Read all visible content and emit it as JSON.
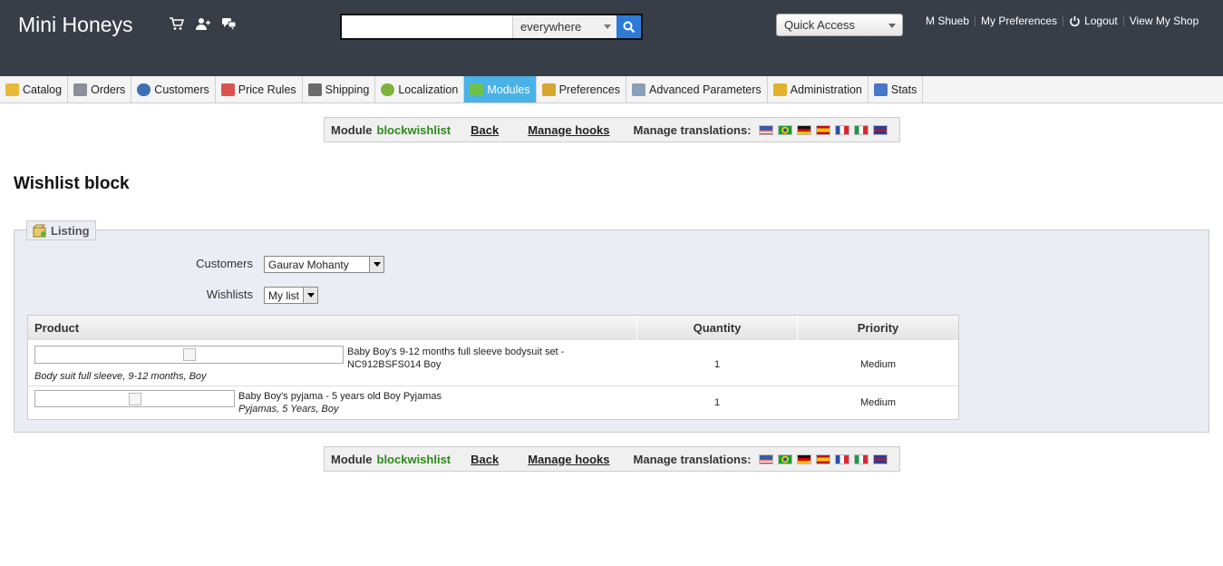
{
  "header": {
    "shop_name": "Mini Honeys",
    "search": {
      "value": "",
      "scope": "everywhere"
    },
    "quick_access": "Quick Access",
    "user_links": [
      "M Shueb",
      "My Preferences",
      "Logout",
      "View My Shop"
    ]
  },
  "tabs": [
    {
      "label": "Catalog",
      "icon": "folder-icon",
      "color": "#e8b93a"
    },
    {
      "label": "Orders",
      "icon": "cart-icon",
      "color": "#8a8f99"
    },
    {
      "label": "Customers",
      "icon": "customer-icon",
      "color": "#3d6fb8"
    },
    {
      "label": "Price Rules",
      "icon": "price-rules-icon",
      "color": "#d9534f"
    },
    {
      "label": "Shipping",
      "icon": "truck-icon",
      "color": "#6b6b6b"
    },
    {
      "label": "Localization",
      "icon": "globe-icon",
      "color": "#7bb33b"
    },
    {
      "label": "Modules",
      "icon": "puzzle-icon",
      "color": "#6cc24a",
      "active": true
    },
    {
      "label": "Preferences",
      "icon": "preferences-icon",
      "color": "#d6a62f"
    },
    {
      "label": "Advanced Parameters",
      "icon": "wrench-icon",
      "color": "#8aa0b8"
    },
    {
      "label": "Administration",
      "icon": "key-icon",
      "color": "#e1b12c"
    },
    {
      "label": "Stats",
      "icon": "bar-chart-icon",
      "color": "#4a76c9"
    }
  ],
  "module_bar": {
    "module_label": "Module",
    "module_name": "blockwishlist",
    "back": "Back",
    "manage_hooks": "Manage hooks",
    "manage_translations": "Manage translations:",
    "flags": [
      "us-flag-icon",
      "br-flag-icon",
      "de-flag-icon",
      "es-flag-icon",
      "fr-flag-icon",
      "it-flag-icon",
      "gb-flag-icon"
    ]
  },
  "page_title": "Wishlist block",
  "listing": {
    "legend": "Listing",
    "customers_label": "Customers",
    "customers_value": "Gaurav Mohanty",
    "wishlists_label": "Wishlists",
    "wishlists_value": "My list",
    "columns": [
      "Product",
      "Quantity",
      "Priority"
    ],
    "rows": [
      {
        "name": "Baby Boy's 9-12 months full sleeve bodysuit set - NC912BSFS014 Boy",
        "name_line1": "Baby Boy's 9-12 months full sleeve bodysuit set -",
        "name_line2": "NC912BSFS014 Boy",
        "attributes": "Body suit full sleeve, 9-12 months, Boy",
        "quantity": "1",
        "priority": "Medium"
      },
      {
        "name": "Baby Boy's pyjama - 5 years old Boy Pyjamas",
        "attributes": "Pyjamas, 5 Years, Boy",
        "quantity": "1",
        "priority": "Medium"
      }
    ]
  }
}
